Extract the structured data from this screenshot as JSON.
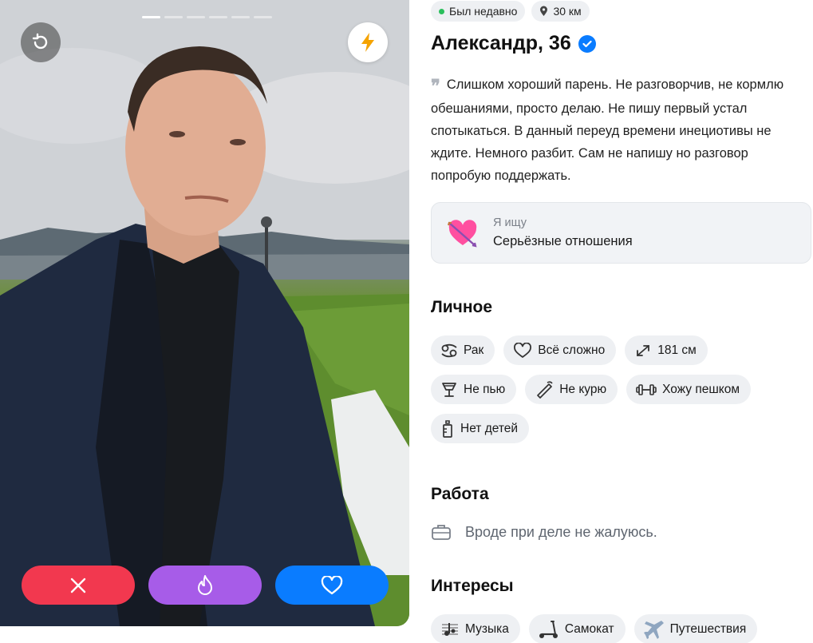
{
  "photo": {
    "progress_total": 6,
    "progress_active": 1
  },
  "actions": {
    "dislike_color": "#f2384f",
    "superlike_color": "#a75ce8",
    "like_color": "#0a7cff"
  },
  "profile": {
    "status": "Был недавно",
    "distance": "30 км",
    "name_age": "Александр, 36",
    "verified": true,
    "bio": "Слишком хороший парень. Не разговорчив, не кормлю обешаниями, просто делаю. Не пишу первый устал спотыкаться. В данный переуд времени инециотивы не ждите. Немного разбит. Сам не напишу но разговор попробую поддержать.",
    "seeking_label": "Я ищу",
    "seeking_value": "Серьёзные отношения"
  },
  "personal": {
    "title": "Личное",
    "tags": [
      {
        "icon": "cancer-zodiac-icon",
        "label": "Рак"
      },
      {
        "icon": "heart-outline-icon",
        "label": "Всё сложно"
      },
      {
        "icon": "height-arrows-icon",
        "label": "181 см"
      },
      {
        "icon": "glass-icon",
        "label": "Не пью"
      },
      {
        "icon": "no-smoking-icon",
        "label": "Не курю"
      },
      {
        "icon": "dumbbell-icon",
        "label": "Хожу пешком"
      },
      {
        "icon": "baby-bottle-icon",
        "label": "Нет детей"
      }
    ]
  },
  "work": {
    "title": "Работа",
    "text": "Вроде при деле не жалуюсь."
  },
  "interests": {
    "title": "Интересы",
    "tags": [
      {
        "icon": "music-notes-icon",
        "label": "Музыка"
      },
      {
        "icon": "scooter-icon",
        "label": "Самокат"
      },
      {
        "icon": "airplane-icon",
        "label": "Путешествия"
      }
    ]
  }
}
